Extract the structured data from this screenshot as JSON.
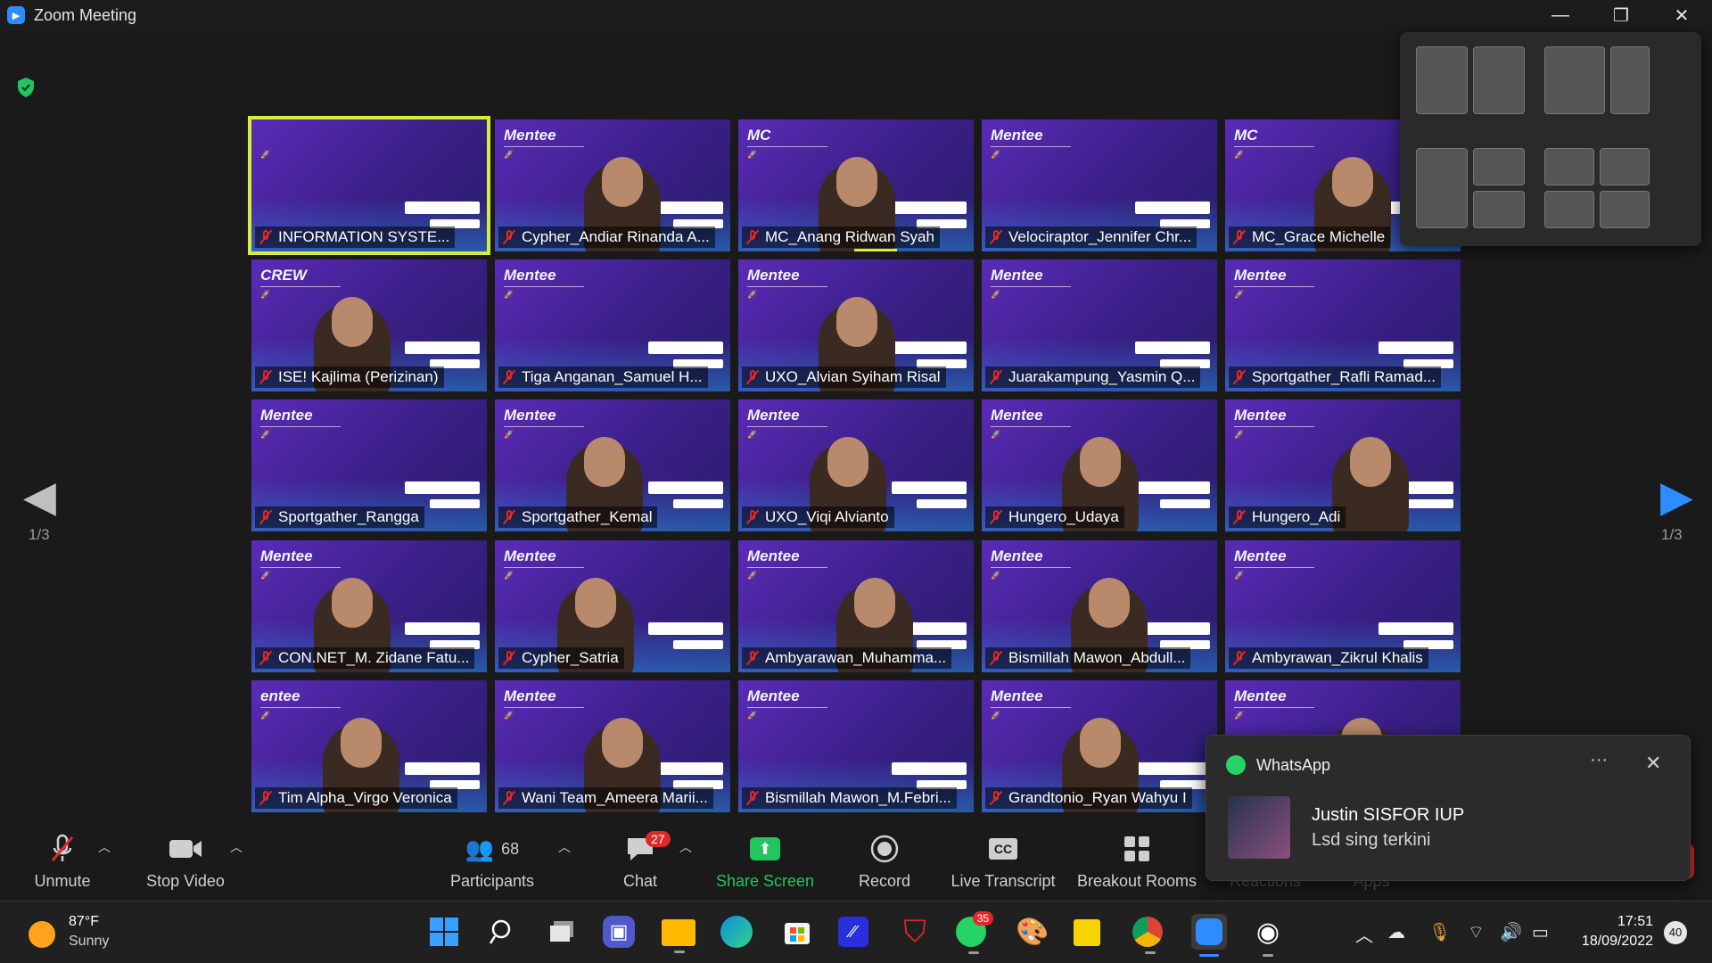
{
  "window": {
    "title": "Zoom Meeting",
    "minimize": "—",
    "restore": "❐",
    "close": "✕"
  },
  "pagination": {
    "left": "1/3",
    "right": "1/3"
  },
  "tiles": [
    {
      "role": "",
      "name": "INFORMATION SYSTE...",
      "active": true
    },
    {
      "role": "Mentee",
      "name": "Cypher_Andiar Rinanda A..."
    },
    {
      "role": "MC",
      "name": "MC_Anang Ridwan Syah"
    },
    {
      "role": "Mentee",
      "name": "Velociraptor_Jennifer Chr..."
    },
    {
      "role": "MC",
      "name": "MC_Grace Michelle"
    },
    {
      "role": "CREW",
      "name": "ISE! Kajlima (Perizinan)"
    },
    {
      "role": "Mentee",
      "name": "Tiga Anganan_Samuel H..."
    },
    {
      "role": "Mentee",
      "name": "UXO_Alvian Syiham Risal"
    },
    {
      "role": "Mentee",
      "name": "Juarakampung_Yasmin Q..."
    },
    {
      "role": "Mentee",
      "name": "Sportgather_Rafli Ramad..."
    },
    {
      "role": "Mentee",
      "name": "Sportgather_Rangga"
    },
    {
      "role": "Mentee",
      "name": "Sportgather_Kemal"
    },
    {
      "role": "Mentee",
      "name": "UXO_Viqi Alvianto"
    },
    {
      "role": "Mentee",
      "name": "Hungero_Udaya"
    },
    {
      "role": "Mentee",
      "name": "Hungero_Adi"
    },
    {
      "role": "Mentee",
      "name": "CON.NET_M. Zidane Fatu..."
    },
    {
      "role": "Mentee",
      "name": "Cypher_Satria"
    },
    {
      "role": "Mentee",
      "name": "Ambyarawan_Muhamma..."
    },
    {
      "role": "Mentee",
      "name": "Bismillah Mawon_Abdull..."
    },
    {
      "role": "Mentee",
      "name": "Ambyrawan_Zikrul Khalis"
    },
    {
      "role": "entee",
      "name": "Tim Alpha_Virgo Veronica"
    },
    {
      "role": "Mentee",
      "name": "Wani Team_Ameera Marii..."
    },
    {
      "role": "Mentee",
      "name": "Bismillah Mawon_M.Febri..."
    },
    {
      "role": "Mentee",
      "name": "Grandtonio_Ryan Wahyu I"
    },
    {
      "role": "Mentee",
      "name": ""
    }
  ],
  "toast": {
    "app": "WhatsApp",
    "sender": "Justin SISFOR IUP",
    "message": "Lsd sing terkini",
    "more": "···",
    "close": "✕"
  },
  "toolbar": {
    "unmute": "Unmute",
    "stop_video": "Stop Video",
    "participants": "Participants",
    "participants_count": "68",
    "chat": "Chat",
    "chat_badge": "27",
    "share_screen": "Share Screen",
    "record": "Record",
    "live_transcript": "Live Transcript",
    "cc": "CC",
    "breakout_rooms": "Breakout Rooms",
    "reactions": "Reactions",
    "apps": "Apps"
  },
  "taskbar": {
    "temp": "87°F",
    "condition": "Sunny",
    "whatsapp_badge": "35",
    "time": "17:51",
    "date": "18/09/2022",
    "notifications": "40"
  },
  "colors": {
    "accent": "#2d8cff",
    "active_speaker": "#d4ee3a",
    "muted": "#e02828",
    "share": "#22c55e"
  }
}
